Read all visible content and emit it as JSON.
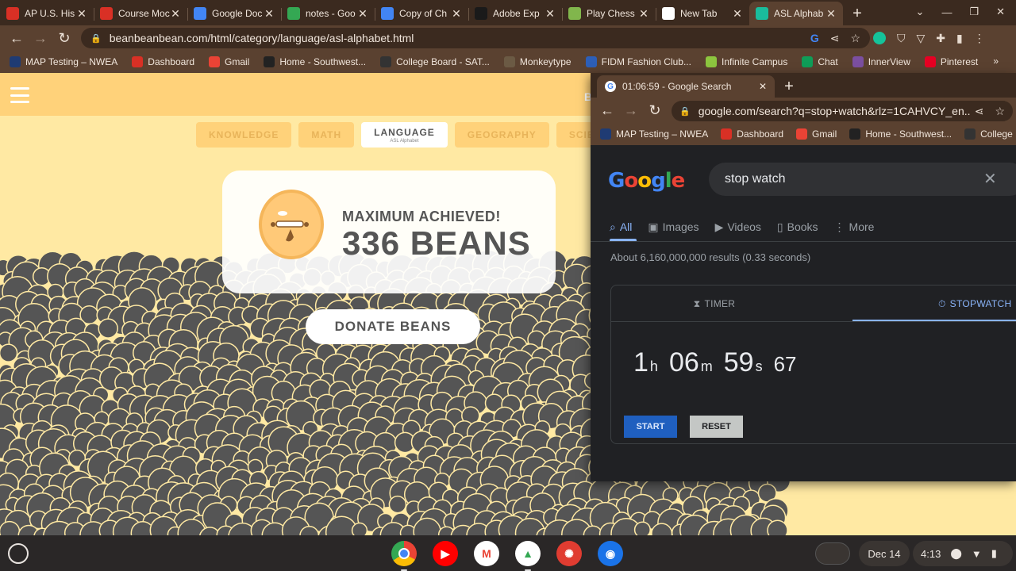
{
  "tabs": [
    {
      "title": "AP U.S. His",
      "icon": "red-circle-icon",
      "color": "#d93025"
    },
    {
      "title": "Course Moc",
      "icon": "red-circle-icon",
      "color": "#d93025"
    },
    {
      "title": "Google Doc",
      "icon": "docs-icon",
      "color": "#4285f4"
    },
    {
      "title": "notes - Goo",
      "icon": "drive-icon",
      "color": "#34a853"
    },
    {
      "title": "Copy of Ch",
      "icon": "docs-icon",
      "color": "#4285f4"
    },
    {
      "title": "Adobe Exp",
      "icon": "adobe-icon",
      "color": "#1a1a1a"
    },
    {
      "title": "Play Chess",
      "icon": "chess-icon",
      "color": "#81b64c"
    },
    {
      "title": "New Tab",
      "icon": "chrome-icon",
      "color": "#ffffff"
    },
    {
      "title": "ASL Alphab",
      "icon": "teal-dot-icon",
      "color": "#1abc9c"
    }
  ],
  "address": {
    "url": "beanbeanbean.com/html/category/language/asl-alphabet.html"
  },
  "bookmarks": [
    {
      "label": "MAP Testing – NWEA",
      "color": "#1f3b73"
    },
    {
      "label": "Dashboard",
      "color": "#d93025"
    },
    {
      "label": "Gmail",
      "color": "#ea4335"
    },
    {
      "label": "Home - Southwest...",
      "color": "#222222"
    },
    {
      "label": "College Board - SAT...",
      "color": "#333333"
    },
    {
      "label": "Monkeytype",
      "color": "#6b5a44"
    },
    {
      "label": "FIDM Fashion Club...",
      "color": "#2d5fb8"
    },
    {
      "label": "Infinite Campus",
      "color": "#8dc63f"
    },
    {
      "label": "Chat",
      "color": "#0f9d58"
    },
    {
      "label": "InnerView",
      "color": "#7b4fa0"
    },
    {
      "label": "Pinterest",
      "color": "#e60023"
    }
  ],
  "site": {
    "categories": [
      {
        "label": "KNOWLEDGE"
      },
      {
        "label": "MATH"
      },
      {
        "label": "LANGUAGE",
        "sub": "ASL Alphabet"
      },
      {
        "label": "GEOGRAPHY"
      },
      {
        "label": "SCIENCE"
      }
    ],
    "logo_letter": "B",
    "card": {
      "line1": "MAXIMUM ACHIEVED!",
      "line2": "336 BEANS"
    },
    "donate_label": "DONATE BEANS"
  },
  "popup": {
    "tab_title": "01:06:59 - Google Search",
    "url": "google.com/search?q=stop+watch&rlz=1CAHVCY_en...",
    "bookmarks": [
      "MAP Testing – NWEA",
      "Dashboard",
      "Gmail",
      "Home - Southwest...",
      "College Boa"
    ],
    "logo": "Google",
    "query": "stop watch",
    "search_tabs": [
      "All",
      "Images",
      "Videos",
      "Books",
      "More"
    ],
    "results_text": "About 6,160,000,000 results (0.33 seconds)",
    "stopwatch": {
      "timer_label": "TIMER",
      "stopwatch_label": "STOPWATCH",
      "hours": "1",
      "h": "h",
      "minutes": "06",
      "m": "m",
      "seconds": "59",
      "s": "s",
      "centis": "67",
      "start_label": "START",
      "reset_label": "RESET"
    }
  },
  "shelf": {
    "date": "Dec 14",
    "time": "4:13"
  }
}
